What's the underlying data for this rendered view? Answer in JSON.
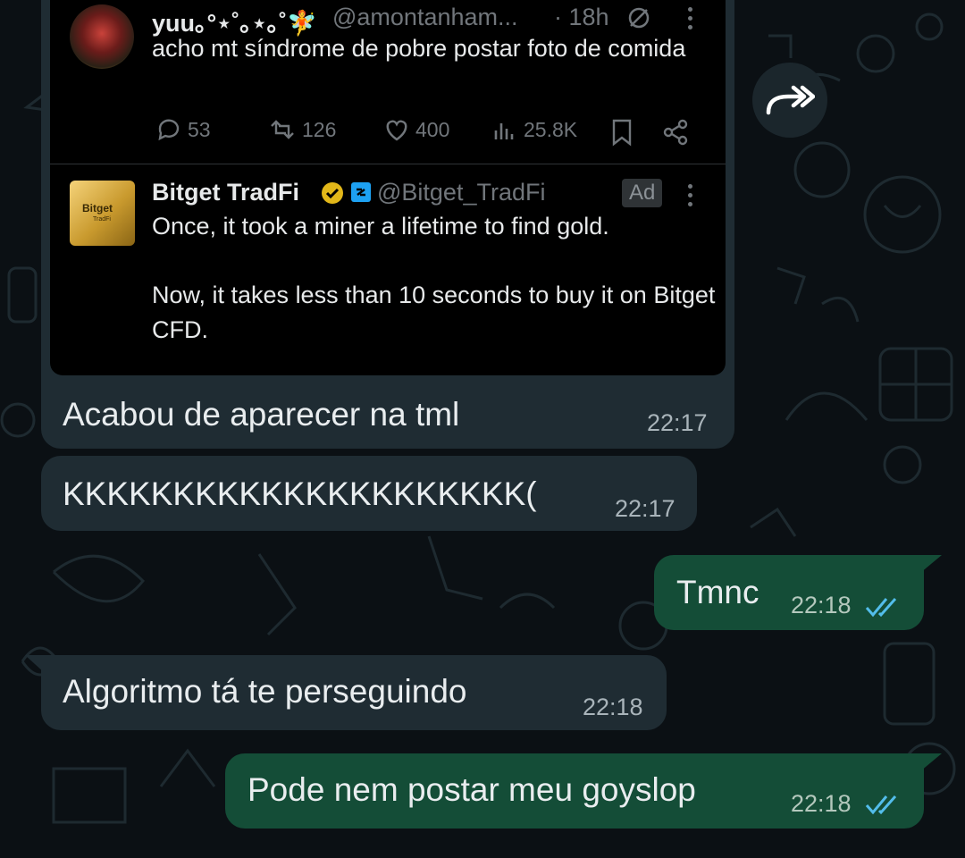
{
  "colors": {
    "background": "#0b1014",
    "incoming_bubble": "#1f2c33",
    "outgoing_bubble": "#144d37",
    "read_ticks": "#53bdeb",
    "tweet_background": "#000000"
  },
  "forward_button": {
    "icon": "forward-double-arrow-icon"
  },
  "tweet_post": {
    "display_name": "yuu｡°⋆˚｡⋆｡˚🧚",
    "handle": "@amontanham...",
    "time": "· 18h",
    "text": "acho mt síndrome de pobre postar foto de comida",
    "stats": {
      "replies": "53",
      "reposts": "126",
      "likes": "400",
      "views": "25.8K"
    }
  },
  "tweet_ad": {
    "logo_text": "Bitget",
    "logo_subtext": "TradFi",
    "display_name": "Bitget TradFi",
    "handle": "@Bitget_TradFi",
    "ad_label": "Ad",
    "text_line1": "Once, it took a miner a lifetime to find gold.",
    "text_line2": "Now, it takes less than 10 seconds to buy it on Bitget CFD."
  },
  "messages": [
    {
      "direction": "in",
      "text": "Acabou de aparecer na tml",
      "time": "22:17"
    },
    {
      "direction": "in",
      "text": "KKKKKKKKKKKKKKKKKKKKK(",
      "time": "22:17"
    },
    {
      "direction": "out",
      "text": "Tmnc",
      "time": "22:18",
      "status": "read"
    },
    {
      "direction": "in",
      "text": "Algoritmo tá te perseguindo",
      "time": "22:18"
    },
    {
      "direction": "out",
      "text": "Pode nem postar meu goyslop",
      "time": "22:18",
      "status": "read"
    }
  ]
}
